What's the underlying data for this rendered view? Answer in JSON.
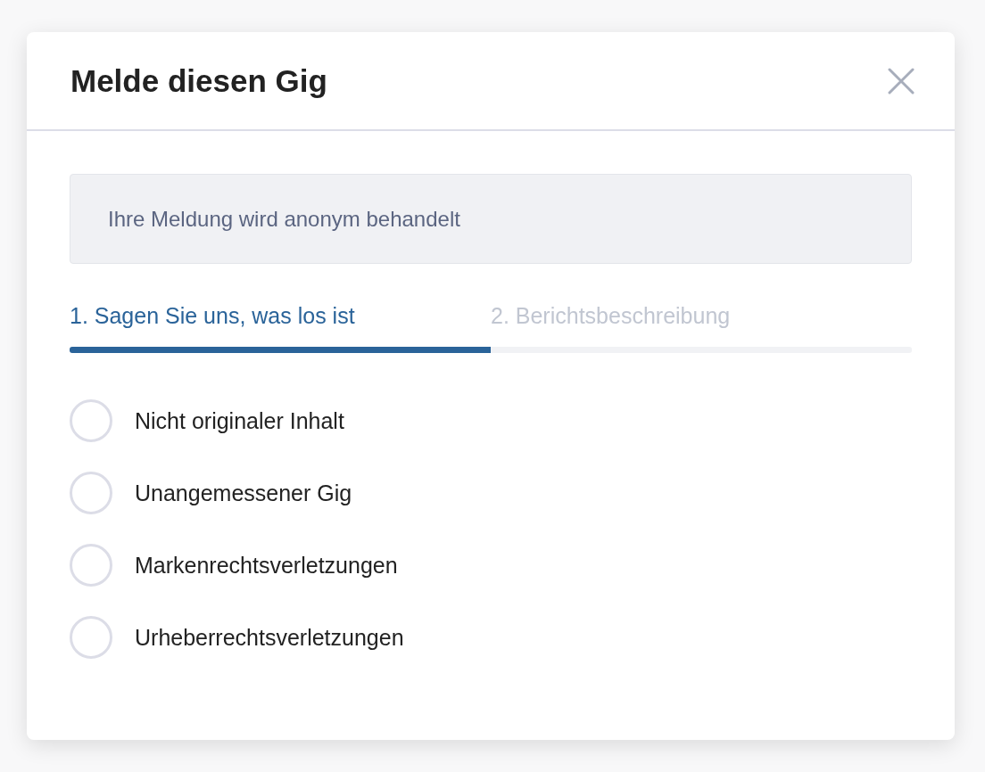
{
  "dialog": {
    "title": "Melde diesen Gig"
  },
  "notice": "Ihre Meldung wird anonym behandelt",
  "steps": [
    {
      "label": "1. Sagen Sie uns, was los ist",
      "selected": true
    },
    {
      "label": "2. Berichtsbeschreibung",
      "selected": false
    }
  ],
  "progress": {
    "level": 0.5
  },
  "options": [
    {
      "label": "Nicht originaler Inhalt",
      "selected": false
    },
    {
      "label": "Unangemessener Gig",
      "selected": false
    },
    {
      "label": "Markenrechtsverletzungen",
      "selected": false
    },
    {
      "label": "Urheberrechtsverletzungen",
      "selected": false
    }
  ]
}
